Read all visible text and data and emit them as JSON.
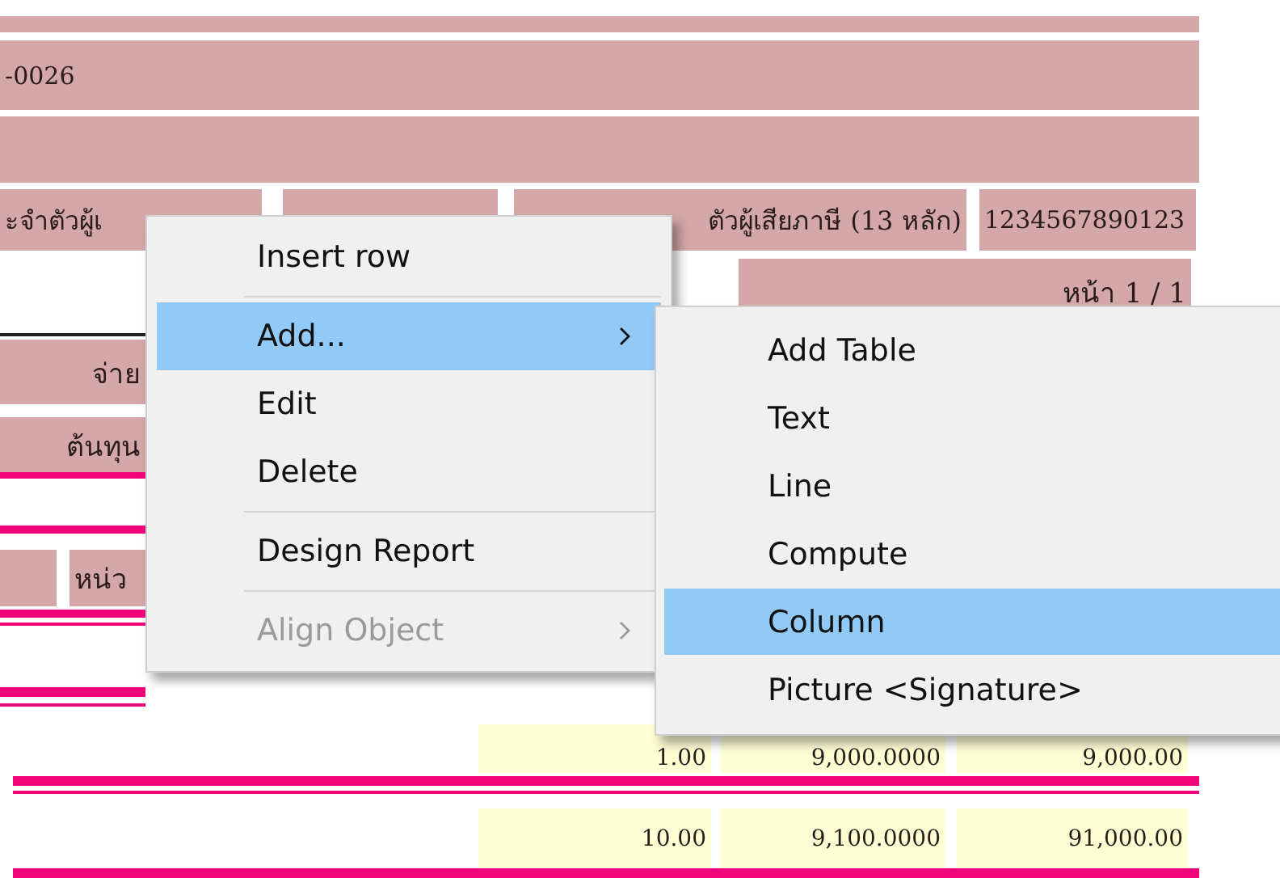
{
  "report_cells": [
    {
      "text": "-0026"
    },
    {
      "text": "ะจำตัวผู้เ"
    },
    {
      "text": "ตัวผู้เสียภาษี (13 หลัก)"
    },
    {
      "text": "1234567890123"
    },
    {
      "text": "หน้า 1 / 1"
    },
    {
      "text": "จ่าย"
    },
    {
      "text": "ต้นทุน"
    },
    {
      "text": "หน่ว"
    },
    {
      "text": "1.00"
    },
    {
      "text": "9,000.0000"
    },
    {
      "text": "9,000.00"
    },
    {
      "text": "10.00"
    },
    {
      "text": "9,100.0000"
    },
    {
      "text": "91,000.00"
    }
  ],
  "context_menu": {
    "items": [
      {
        "kind": "item",
        "label": "Insert row",
        "selected": false,
        "disabled": false,
        "submenu": false
      },
      {
        "kind": "separator"
      },
      {
        "kind": "item",
        "label": "Add...",
        "selected": true,
        "disabled": false,
        "submenu": true
      },
      {
        "kind": "item",
        "label": "Edit",
        "selected": false,
        "disabled": false,
        "submenu": false
      },
      {
        "kind": "item",
        "label": "Delete",
        "selected": false,
        "disabled": false,
        "submenu": false
      },
      {
        "kind": "separator"
      },
      {
        "kind": "item",
        "label": "Design Report",
        "selected": false,
        "disabled": false,
        "submenu": false
      },
      {
        "kind": "separator"
      },
      {
        "kind": "item",
        "label": "Align Object",
        "selected": false,
        "disabled": true,
        "submenu": true
      }
    ]
  },
  "submenu": {
    "items": [
      {
        "label": "Add Table",
        "selected": false
      },
      {
        "label": "Text",
        "selected": false
      },
      {
        "label": "Line",
        "selected": false
      },
      {
        "label": "Compute",
        "selected": false
      },
      {
        "label": "Column",
        "selected": true
      },
      {
        "label": "Picture <Signature>",
        "selected": false
      }
    ]
  }
}
